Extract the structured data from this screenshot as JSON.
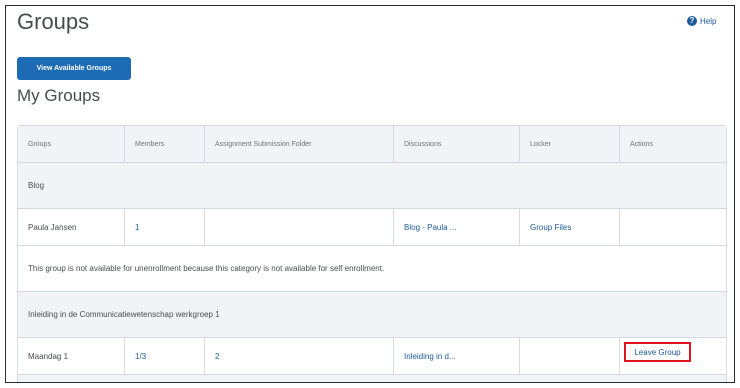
{
  "page": {
    "title": "Groups",
    "help_label": "Help",
    "help_icon": "help-circle-icon",
    "view_button_label": "View Available Groups",
    "section_title": "My Groups"
  },
  "colors": {
    "primary": "#1d6cb5",
    "link": "#1d5a9a",
    "highlight": "#e0141e",
    "border": "#d3d9e3",
    "row_shade": "#f1f3f6"
  },
  "table": {
    "columns": [
      "Groups",
      "Members",
      "Assignment Submission Folder",
      "Discussions",
      "Locker",
      "Actions"
    ],
    "category_1": "Blog",
    "group_1": {
      "name": "Paula Jansen",
      "members": "1",
      "folder": "",
      "discussions": "Blog - Paula ...",
      "locker": "Group Files",
      "action": ""
    },
    "notice": "This group is not available for unenrollment because this category is not available for self enrollment.",
    "category_2": "Inleiding in de Communicatiewetenschap werkgroep 1",
    "group_2": {
      "name": "Maandag 1",
      "members": "1/3",
      "folder": "2",
      "discussions": "Inleiding in d...",
      "locker": "",
      "action": "Leave Group"
    }
  }
}
